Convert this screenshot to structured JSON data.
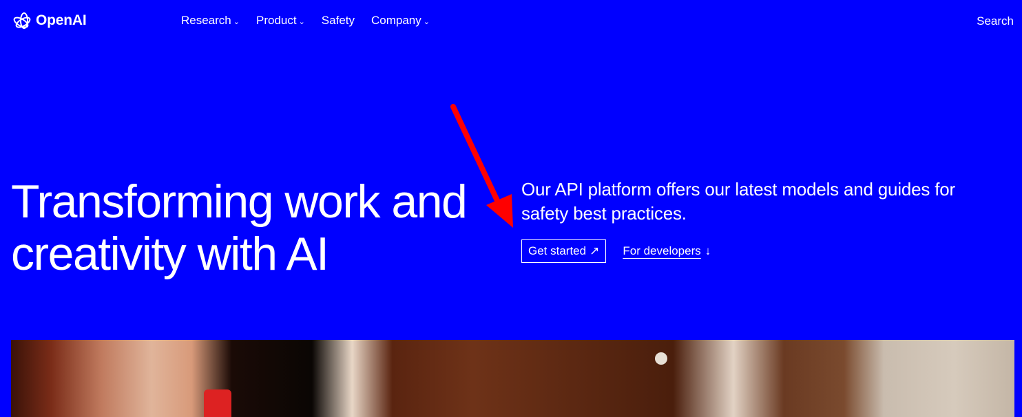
{
  "brand": {
    "logo_icon": "openai-knot-icon",
    "name": "OpenAI"
  },
  "nav": {
    "items": [
      {
        "label": "Research",
        "has_dropdown": true
      },
      {
        "label": "Product",
        "has_dropdown": true
      },
      {
        "label": "Safety",
        "has_dropdown": false
      },
      {
        "label": "Company",
        "has_dropdown": true
      }
    ],
    "chevron_glyph": "⌄",
    "search_label": "Search"
  },
  "hero": {
    "title": "Transforming work and creativity with AI",
    "description": "Our API platform offers our latest models and guides for safety best practices.",
    "cta_primary": {
      "label": "Get started",
      "icon_glyph": "↗",
      "icon": "arrow-up-right-icon"
    },
    "cta_secondary": {
      "label": "For developers",
      "icon_glyph": "↓",
      "icon": "arrow-down-icon"
    }
  },
  "annotation": {
    "type": "red-arrow",
    "points_to": "Get started",
    "color": "#ff0000"
  },
  "colors": {
    "background": "#0000ff",
    "text": "#ffffff",
    "annotation": "#ff0000"
  }
}
